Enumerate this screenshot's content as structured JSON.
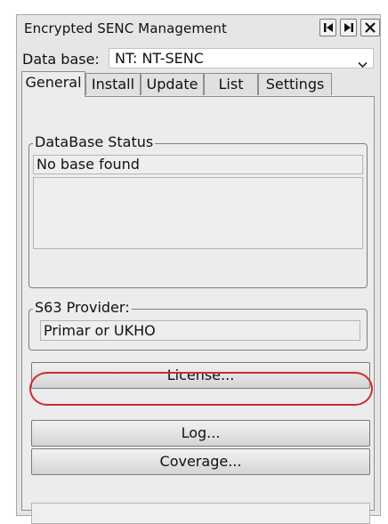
{
  "window": {
    "title": "Encrypted SENC Management"
  },
  "icons": {
    "first": "skip-to-start-icon",
    "last": "skip-to-end-icon",
    "close": "close-icon",
    "dropdown": "chevron-down-icon"
  },
  "database": {
    "label": "Data base:",
    "selected": "NT: NT-SENC"
  },
  "tabs": [
    {
      "label": "General",
      "active": true
    },
    {
      "label": "Install",
      "active": false
    },
    {
      "label": "Update",
      "active": false
    },
    {
      "label": "List",
      "active": false
    },
    {
      "label": "Settings",
      "active": false
    }
  ],
  "db_status": {
    "title": "DataBase Status",
    "value": "No base found",
    "details": ""
  },
  "provider": {
    "title": "S63 Provider:",
    "value": "Primar or UKHO"
  },
  "buttons": {
    "license": "License...",
    "log": "Log...",
    "coverage": "Coverage..."
  },
  "status_bar": "",
  "colors": {
    "highlight": "#cf2b2b",
    "window_bg": "#e6e6e6"
  }
}
